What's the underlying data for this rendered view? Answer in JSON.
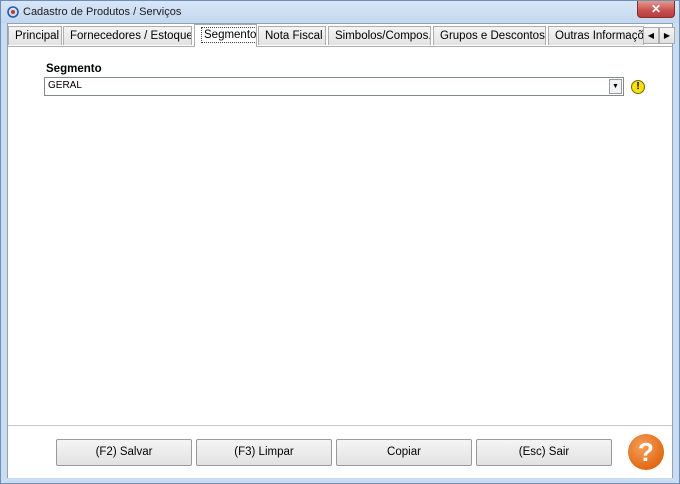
{
  "window": {
    "title": "Cadastro de Produtos / Serviços",
    "close_label": "✕"
  },
  "tabs": [
    {
      "label": "Principal"
    },
    {
      "label": "Fornecedores / Estoque"
    },
    {
      "label": "Segmento",
      "active": true
    },
    {
      "label": "Nota Fiscal"
    },
    {
      "label": "Simbolos/Compos."
    },
    {
      "label": "Grupos e Descontos"
    },
    {
      "label": "Outras Informações"
    }
  ],
  "tab_scroll": {
    "left_icon": "triangle-left-icon",
    "right_icon": "triangle-right-icon"
  },
  "segmento": {
    "label": "Segmento",
    "selected_value": "GERAL",
    "warning_icon": "exclamation-icon",
    "warning_color": "#f4e013"
  },
  "buttons": {
    "save": "(F2) Salvar",
    "clear": "(F3) Limpar",
    "copy": "Copiar",
    "exit": "(Esc) Sair",
    "help": "?"
  },
  "colors": {
    "help_orange": "#e36a16",
    "close_red": "#c75050"
  }
}
